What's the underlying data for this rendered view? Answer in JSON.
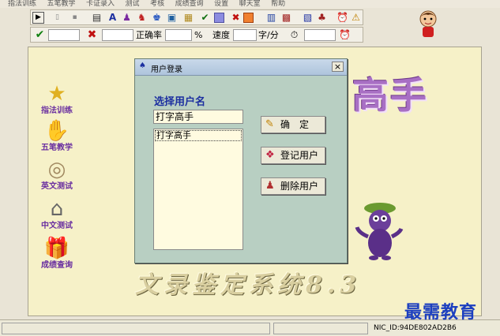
{
  "menu": [
    "指法训练",
    "五笔教学",
    "卡证录入",
    "测试",
    "考核",
    "成绩查询",
    "设置",
    "聊天室",
    "帮助"
  ],
  "toolbar2": {
    "ok_icon": "check-icon",
    "cancel_icon": "x-icon",
    "accuracy_label": "正确率",
    "percent_label": "%",
    "speed_label": "速度",
    "speed_unit": "字/分",
    "timer_icon": "stopwatch-icon",
    "alarm_icon": "alarm-clock-icon"
  },
  "sidebar": [
    {
      "label": "指法训练",
      "icon": "star-icon"
    },
    {
      "label": "五笔教学",
      "icon": "hand-icon"
    },
    {
      "label": "英文测试",
      "icon": "shell-icon"
    },
    {
      "label": "中文测试",
      "icon": "house-icon"
    },
    {
      "label": "成绩查询",
      "icon": "gift-icon"
    }
  ],
  "background": {
    "title_fragment": "高手",
    "bottom_title": "文录鉴定系统8.3"
  },
  "dialog": {
    "title": "用户登录",
    "close": "×",
    "heading": "选择用户名",
    "input_value": "打字高手",
    "list": [
      "打字高手"
    ],
    "buttons": {
      "confirm": "确　定",
      "register": "登记用户",
      "delete": "删除用户"
    }
  },
  "status": {
    "nic": "NIC_ID:94DE802AD2B6"
  },
  "watermark": "最需教育",
  "colors": {
    "accent": "#1c2fa0",
    "dialog_bg": "#b8cfc2",
    "main_bg": "#f6f1c8",
    "sidebar_label": "#6a2fa0"
  }
}
